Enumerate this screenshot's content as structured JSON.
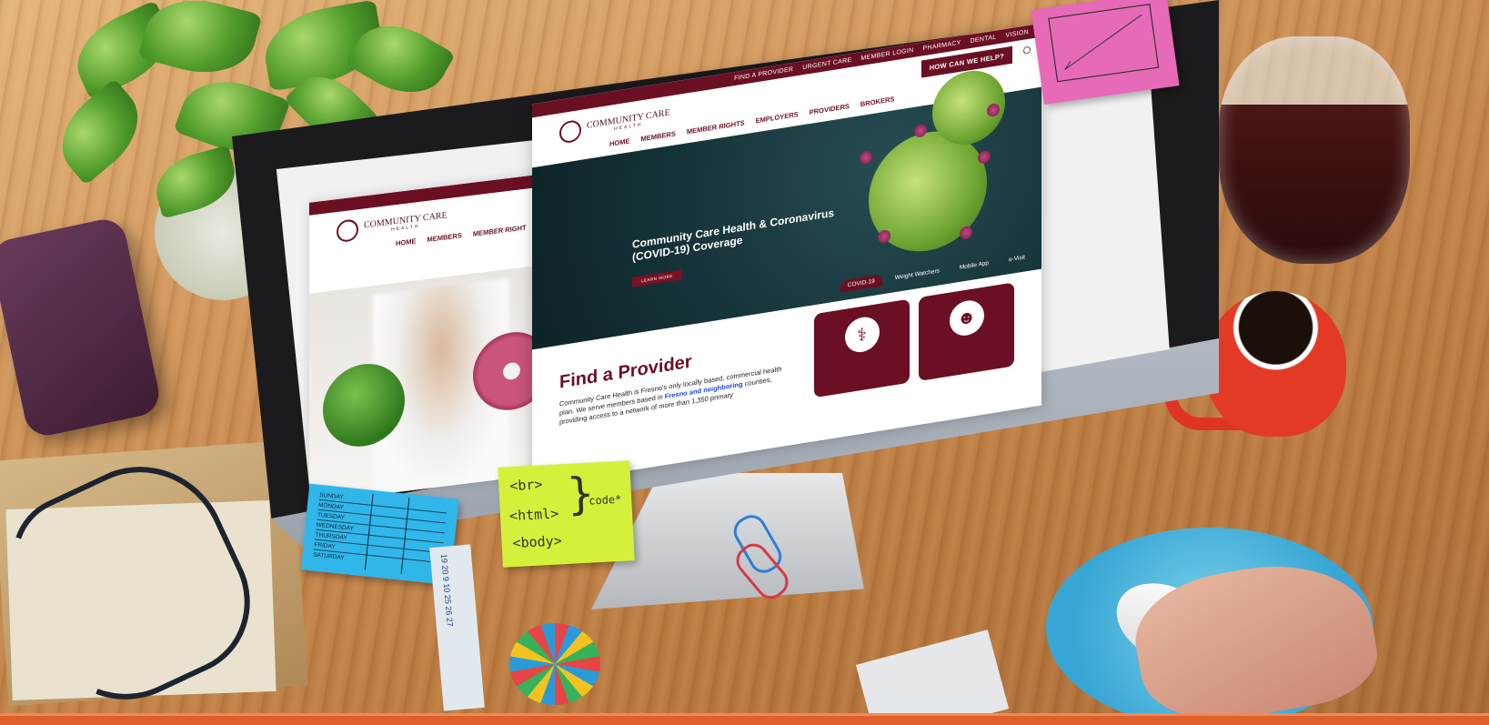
{
  "site": {
    "utility_nav": [
      "FIND A PROVIDER",
      "URGENT CARE",
      "MEMBER LOGIN",
      "PHARMACY",
      "DENTAL",
      "VISION"
    ],
    "logo_text": "COMMUNITY CARE",
    "logo_sub": "HEALTH",
    "main_nav": [
      "HOME",
      "MEMBERS",
      "MEMBER RIGHTS",
      "EMPLOYERS",
      "PROVIDERS",
      "BROKERS"
    ],
    "help_button": "HOW CAN WE HELP?",
    "hero": {
      "title": "Community Care Health & Coronavirus (COVID-19) Coverage",
      "button": "LEARN MORE",
      "tabs": [
        "COVID-19",
        "Weight Watchers",
        "Mobile App",
        "e-Visit"
      ]
    },
    "find_provider": {
      "title": "Find a Provider",
      "body_start": "Community Care Health is Fresno's only locally based, commercial health plan. We serve members based in ",
      "link": "Fresno and neighboring",
      "body_end": " counties, providing access to a network of more than 1,350 primary"
    },
    "back_page": {
      "logo_text": "COMMUNITY CARE",
      "logo_sub": "HEALTH",
      "nav": [
        "HOME",
        "MEMBERS",
        "MEMBER RIGHT"
      ]
    }
  },
  "notes": {
    "yellow": [
      "<br>",
      "<html>",
      "<body>"
    ],
    "yellow_tag": "code*",
    "blue": [
      "SUNDAY",
      "MONDAY",
      "TUESDAY",
      "WEDNESDAY",
      "THURSDAY",
      "FRIDAY",
      "SATURDAY"
    ]
  },
  "ruler_marks": [
    "19",
    "20",
    "9",
    "10",
    "25",
    "26",
    "27"
  ],
  "colors": {
    "brand": "#6b0f22",
    "link": "#1a4bd1",
    "pink_note": "#e66ab8",
    "yellow_note": "#d5f03a",
    "blue_note": "#31b6ea",
    "accent_strip": "#e0602c"
  }
}
